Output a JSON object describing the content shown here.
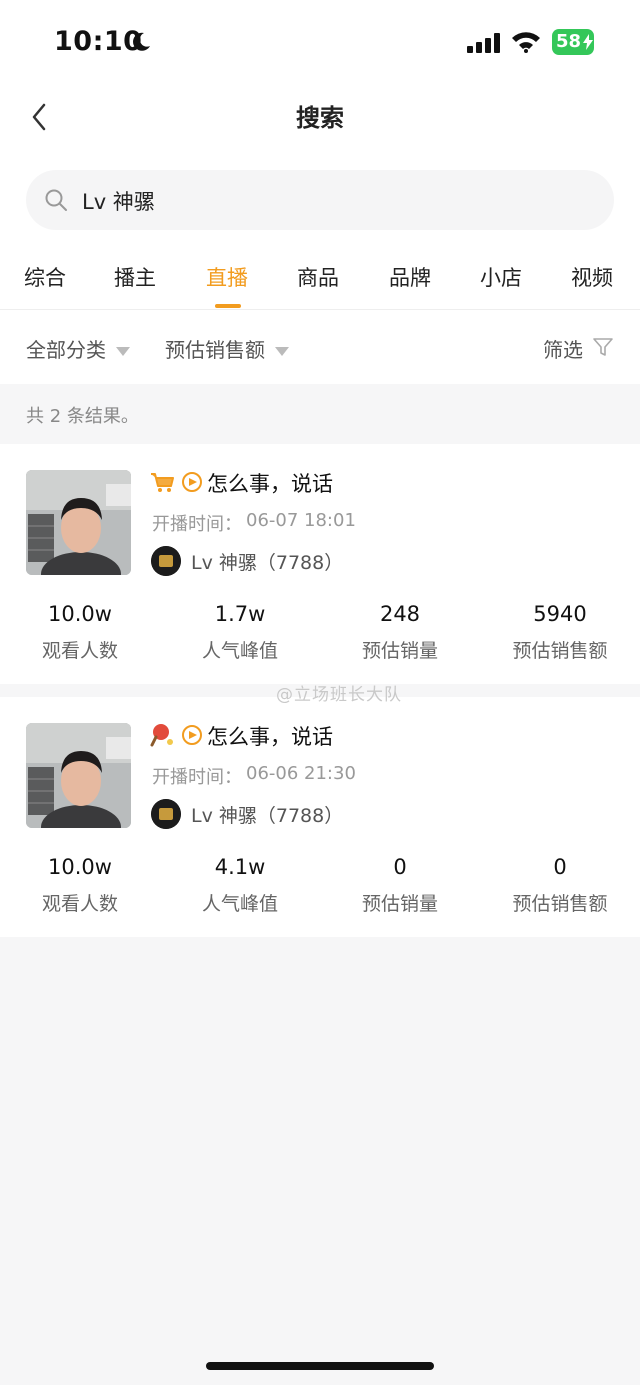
{
  "status": {
    "time": "10:10",
    "battery": "58"
  },
  "nav": {
    "title": "搜索"
  },
  "search": {
    "value": "Lv 神骡"
  },
  "tabs": [
    {
      "label": "综合",
      "active": false
    },
    {
      "label": "播主",
      "active": false
    },
    {
      "label": "直播",
      "active": true
    },
    {
      "label": "商品",
      "active": false
    },
    {
      "label": "品牌",
      "active": false
    },
    {
      "label": "小店",
      "active": false
    },
    {
      "label": "视频",
      "active": false
    }
  ],
  "filters": {
    "category": "全部分类",
    "sort": "预估销售额",
    "screen": "筛选"
  },
  "result_count": "共 2 条结果。",
  "results": [
    {
      "title": "怎么事，说话",
      "badge_icon": "shopping-cart-icon",
      "time_label": "开播时间：",
      "time_value": "06-07 18:01",
      "host": "Lv 神骡（7788）",
      "stats": [
        {
          "value": "10.0w",
          "label": "观看人数"
        },
        {
          "value": "1.7w",
          "label": "人气峰值"
        },
        {
          "value": "248",
          "label": "预估销量"
        },
        {
          "value": "5940",
          "label": "预估销售额"
        }
      ]
    },
    {
      "title": "怎么事，说话",
      "badge_icon": "ping-pong-paddle-icon",
      "time_label": "开播时间：",
      "time_value": "06-06 21:30",
      "host": "Lv 神骡（7788）",
      "stats": [
        {
          "value": "10.0w",
          "label": "观看人数"
        },
        {
          "value": "4.1w",
          "label": "人气峰值"
        },
        {
          "value": "0",
          "label": "预估销量"
        },
        {
          "value": "0",
          "label": "预估销售额"
        }
      ]
    }
  ],
  "watermark": "@立场班长大队",
  "colors": {
    "accent": "#f29c1f",
    "background": "#f6f6f7",
    "battery": "#34c759"
  }
}
